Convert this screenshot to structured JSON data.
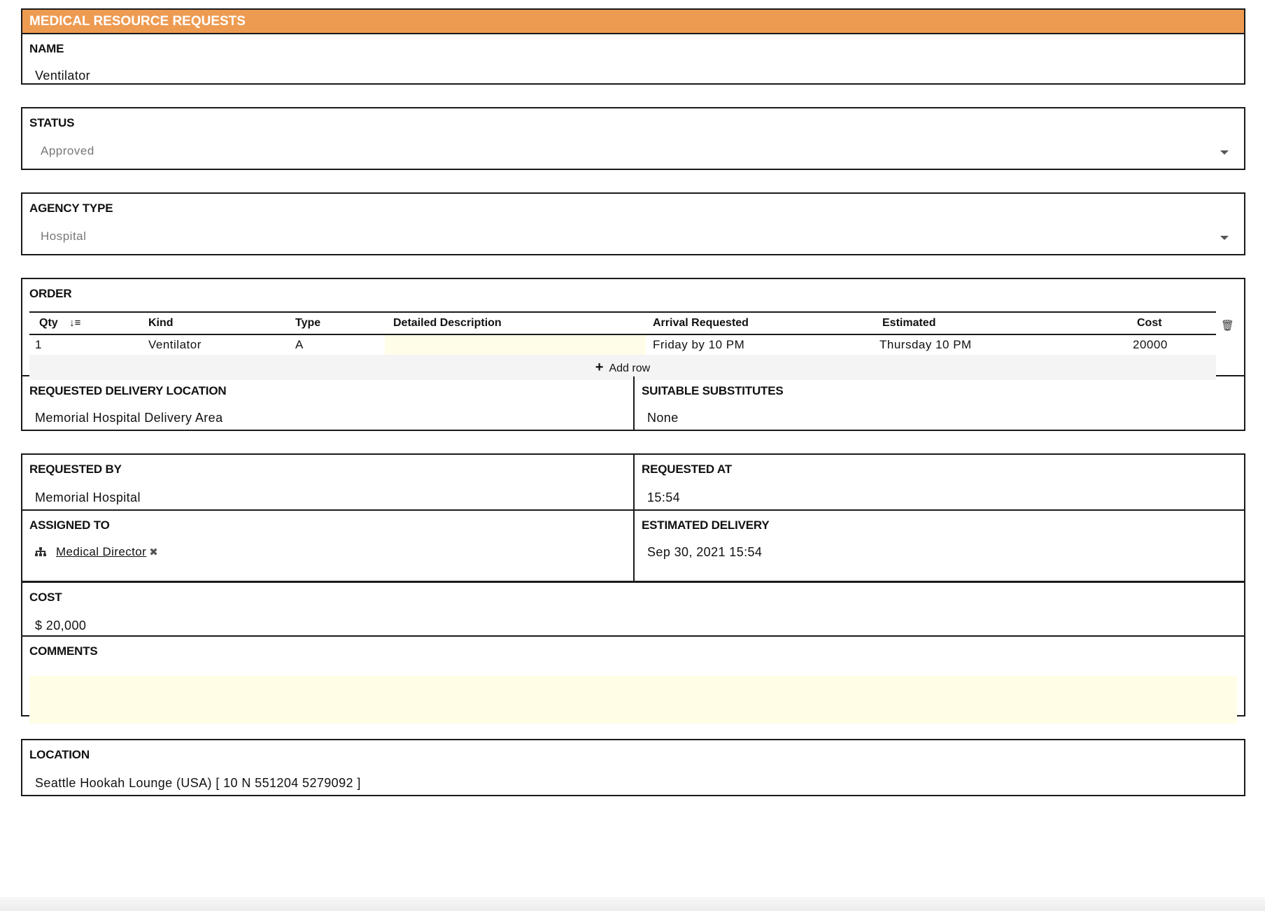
{
  "form": {
    "title": "MEDICAL RESOURCE REQUESTS",
    "name": {
      "label": "NAME",
      "value": "Ventilator"
    },
    "status": {
      "label": "STATUS",
      "value": "Approved"
    },
    "agency_type": {
      "label": "AGENCY TYPE",
      "value": "Hospital"
    },
    "order": {
      "label": "ORDER",
      "columns": [
        "Qty",
        "Kind",
        "Type",
        "Detailed Description",
        "Arrival Requested",
        "Estimated",
        "Cost"
      ],
      "rows": [
        {
          "qty": "1",
          "kind": "Ventilator",
          "type": "A",
          "description": "",
          "arrival": "Friday by 10 PM",
          "estimated": "Thursday 10 PM",
          "cost": "20000"
        }
      ],
      "add_row_label": "Add row"
    },
    "delivery_location": {
      "label": "REQUESTED DELIVERY LOCATION",
      "value": "Memorial Hospital Delivery Area"
    },
    "substitutes": {
      "label": "SUITABLE SUBSTITUTES",
      "value": "None"
    },
    "requested_by": {
      "label": "REQUESTED BY",
      "value": "Memorial Hospital"
    },
    "requested_at": {
      "label": "REQUESTED AT",
      "value": "15:54"
    },
    "assigned_to": {
      "label": "ASSIGNED TO",
      "value": "Medical Director"
    },
    "estimated_delivery": {
      "label": "ESTIMATED DELIVERY",
      "value": "Sep 30, 2021 15:54"
    },
    "cost": {
      "label": "COST",
      "value": "$ 20,000"
    },
    "comments": {
      "label": "COMMENTS",
      "value": ""
    },
    "location": {
      "label": "LOCATION",
      "value": "Seattle Hookah Lounge (USA) [ 10 N 551204 5279092 ]"
    }
  },
  "colors": {
    "header_bg": "#ee9b52",
    "highlight_bg": "#fffde6",
    "border": "#1a1a1a"
  },
  "icons": {
    "sort": "sort-numeric-icon",
    "trash": "trash-icon",
    "add": "plus-icon",
    "org": "org-chart-icon",
    "remove": "close-icon",
    "dropdown": "chevron-down-icon"
  }
}
